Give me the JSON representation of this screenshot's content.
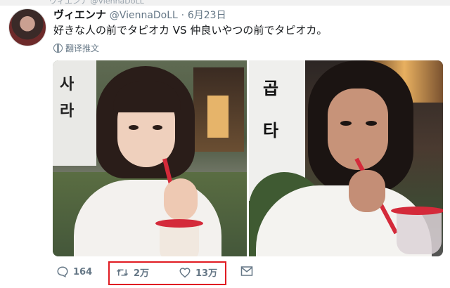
{
  "top_strip": {
    "text": "ヴィエンナ @ViennaDoLL"
  },
  "tweet": {
    "author": {
      "display_name": "ヴィエンナ",
      "handle": "@ViennaDoLL",
      "separator": "·",
      "date": "6月23日"
    },
    "text": "好きな人の前でタピオカ VS 仲良いやつの前でタピオカ。",
    "translate_label": "翻译推文",
    "actions": {
      "reply_count": "164",
      "retweet_count": "2万",
      "like_count": "13万"
    }
  },
  "media": {
    "left_photo_sign_glyphs": [
      "사",
      "라"
    ],
    "right_photo_sign_glyphs": [
      "곱",
      "타"
    ]
  },
  "colors": {
    "text_primary": "#14171a",
    "text_secondary": "#657786",
    "highlight_box": "#e01b22",
    "straw_red": "#d42a3a"
  },
  "icons": [
    "reply-icon",
    "retweet-icon",
    "like-icon",
    "message-icon",
    "globe-icon"
  ]
}
